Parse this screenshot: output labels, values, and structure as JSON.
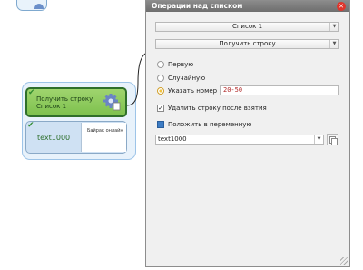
{
  "dialog": {
    "title": "Операции над списком",
    "list_select": "Список 1",
    "operation_select": "Получить строку",
    "options": [
      {
        "label": "Первую",
        "checked": false
      },
      {
        "label": "Случайную",
        "checked": false
      },
      {
        "label": "Указать номер",
        "checked": true
      }
    ],
    "range_value": "20-50",
    "remove_after_take": {
      "label": "Удалить строку после взятия",
      "checked": true
    },
    "store_in_variable": {
      "label": "Положить в переменную"
    },
    "variable_value": "text1000"
  },
  "canvas": {
    "action_node": {
      "line1": "Получить строку",
      "line2": "Список 1"
    },
    "variable_node": {
      "name": "text1000",
      "preview": "Байрак онлайн"
    }
  },
  "colors": {
    "action_green": "#7ec14e",
    "accent_orange": "#f2c341",
    "close_red": "#e0352b"
  }
}
